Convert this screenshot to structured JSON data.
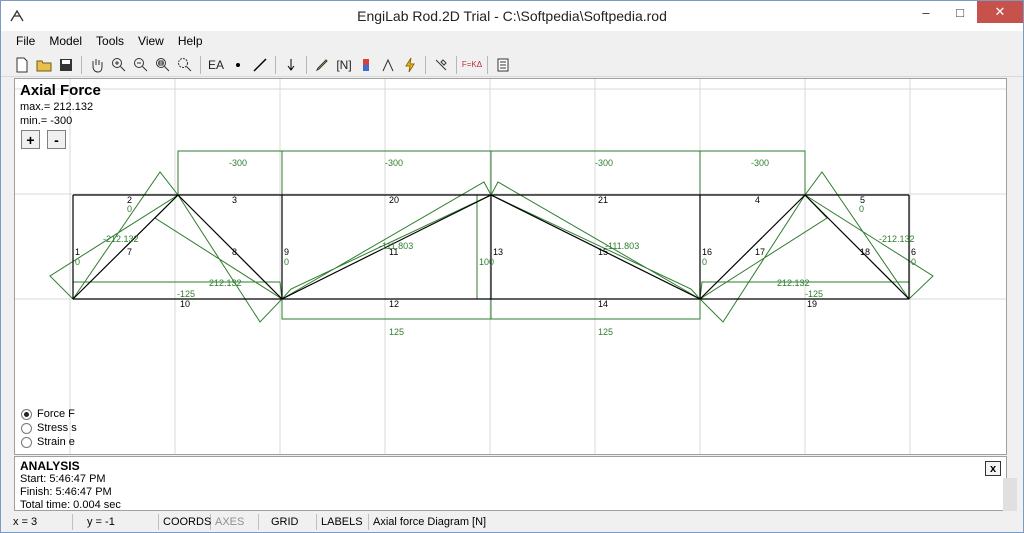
{
  "window": {
    "title": "EngiLab Rod.2D Trial - C:\\Softpedia\\Softpedia.rod"
  },
  "menu": [
    "File",
    "Model",
    "Tools",
    "View",
    "Help"
  ],
  "toolbar": {
    "ea_label": "EA",
    "n_label": "[N]",
    "fk_label": "F=KΔ"
  },
  "diagram": {
    "title": "Axial Force",
    "max": "max.= 212.132",
    "min": "min.= -300",
    "zoom_in": "+",
    "zoom_out": "-"
  },
  "nodes": [
    {
      "id": "1",
      "x": 0,
      "y": 0
    },
    {
      "id": "2",
      "x": 1,
      "y": 1
    },
    {
      "id": "3",
      "x": 2,
      "y": 1
    },
    {
      "id": "4",
      "x": 8,
      "y": 1
    },
    {
      "id": "5",
      "x": 9,
      "y": 1
    },
    {
      "id": "6",
      "x": 10,
      "y": 0
    },
    {
      "id": "7",
      "x": 1,
      "y": 0
    },
    {
      "id": "8",
      "x": 2,
      "y": 0
    },
    {
      "id": "9",
      "x": 2,
      "y": 0
    },
    {
      "id": "10",
      "x": 1,
      "y": 0
    },
    {
      "id": "11",
      "x": 4,
      "y": 0
    },
    {
      "id": "12",
      "x": 4,
      "y": 0
    },
    {
      "id": "13",
      "x": 5,
      "y": 0
    },
    {
      "id": "14",
      "x": 6,
      "y": 0
    },
    {
      "id": "15",
      "x": 6,
      "y": 0
    },
    {
      "id": "16",
      "x": 8,
      "y": 0
    },
    {
      "id": "17",
      "x": 8,
      "y": 0
    },
    {
      "id": "18",
      "x": 9,
      "y": 0
    },
    {
      "id": "19",
      "x": 9,
      "y": 0
    },
    {
      "id": "20",
      "x": 4,
      "y": 1
    },
    {
      "id": "21",
      "x": 6,
      "y": 1
    }
  ],
  "force_labels": [
    "-300",
    "-300",
    "-300",
    "-300",
    "0",
    "0",
    "-212.132",
    "-212.132",
    "0",
    "0",
    "-111.803",
    "-111.803",
    "100",
    "0",
    "0",
    "212.132",
    "-125",
    "212.132",
    "-125",
    "125",
    "125"
  ],
  "radio_options": [
    {
      "label": "Force F",
      "selected": true
    },
    {
      "label": "Stress s",
      "selected": false
    },
    {
      "label": "Strain e",
      "selected": false
    }
  ],
  "analysis": {
    "heading": "ANALYSIS",
    "start": "Start:   5:46:47 PM",
    "finish": "Finish:  5:46:47 PM",
    "total": "Total time:  0.004 sec",
    "close": "x"
  },
  "status": {
    "x": "x = 3",
    "y": "y = -1",
    "coords": "COORDS",
    "axes": "AXES",
    "grid": "GRID",
    "labels": "LABELS",
    "diagram": "Axial force Diagram [N]"
  },
  "colors": {
    "structure": "#000000",
    "diagram": "#2e7d2e",
    "grid": "#d8d8d8"
  }
}
